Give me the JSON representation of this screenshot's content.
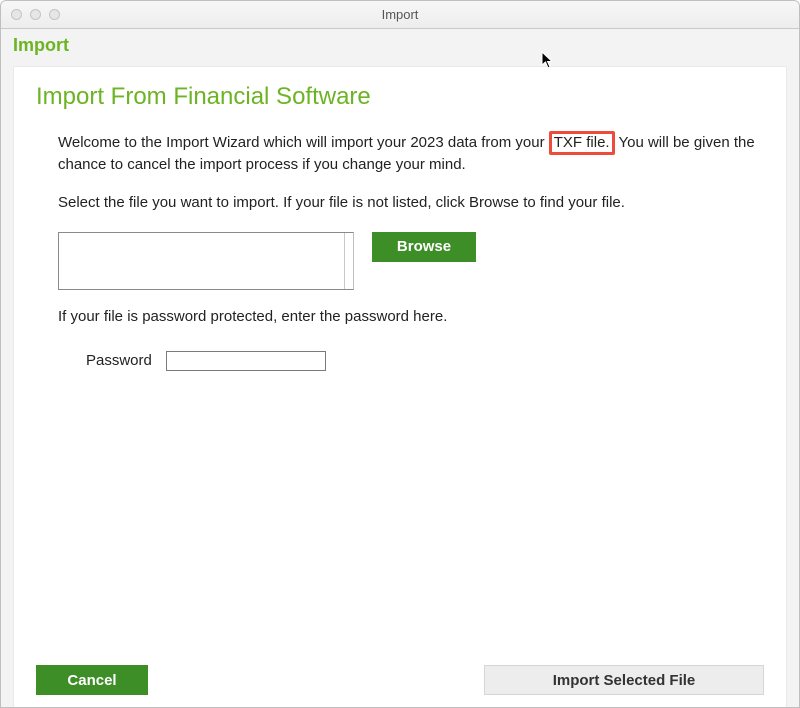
{
  "window": {
    "title": "Import"
  },
  "subheader": "Import",
  "page": {
    "title": "Import From Financial Software",
    "intro_before_highlight": "Welcome to the Import Wizard which will import your 2023 data from your ",
    "intro_highlight": "TXF file.",
    "intro_after_highlight": " You will be given the chance to cancel the import process if you change your mind.",
    "select_file_text": "Select the file you want to import. If your file is not listed, click Browse to find your file.",
    "browse_label": "Browse",
    "password_note": "If your file is password protected, enter the password here.",
    "password_label": "Password",
    "password_value": ""
  },
  "footer": {
    "cancel_label": "Cancel",
    "import_label": "Import Selected File"
  }
}
